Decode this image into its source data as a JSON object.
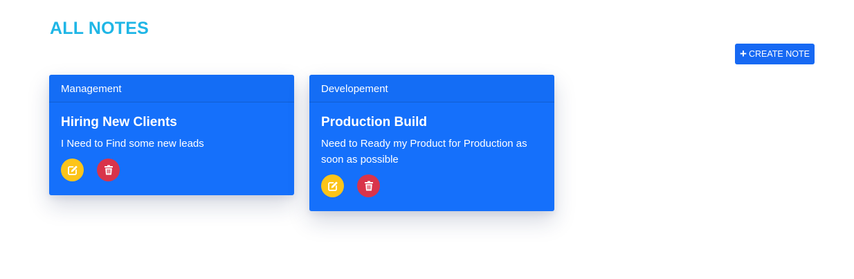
{
  "header": {
    "title": "ALL NOTES",
    "create_label": "CREATE NOTE",
    "create_icon": "plus-icon"
  },
  "notes": [
    {
      "category": "Management",
      "title": "Hiring New Clients",
      "content": "I Need to Find some new leads"
    },
    {
      "category": "Developement",
      "title": "Production Build",
      "content": "Need to Ready my Product for Production as soon as possible"
    }
  ],
  "actions": {
    "edit_icon": "edit-icon",
    "delete_icon": "trash-icon"
  },
  "colors": {
    "title": "#1fb6e6",
    "card": "#1570fb",
    "button": "#1769f3",
    "edit": "#fcc419",
    "delete": "#d9344a"
  }
}
